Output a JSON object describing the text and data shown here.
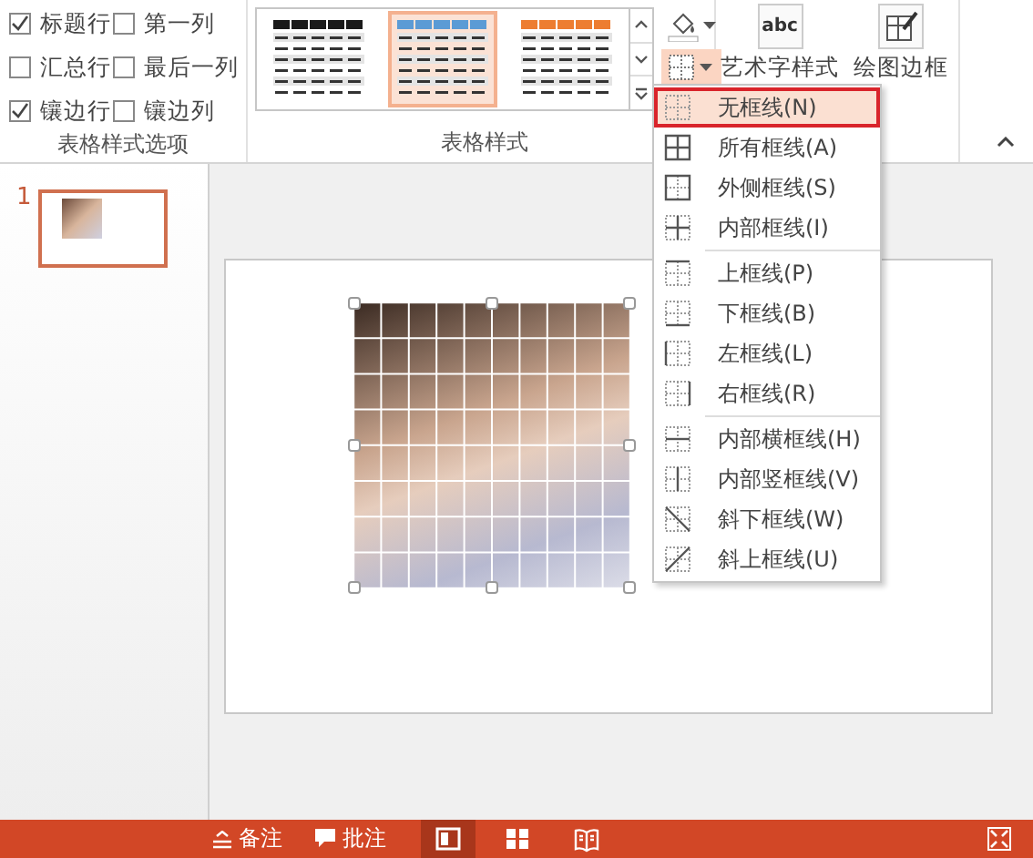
{
  "ribbon": {
    "table_style_options": {
      "label": "表格样式选项",
      "checkboxes": [
        {
          "label": "标题行",
          "checked": true
        },
        {
          "label": "第一列",
          "checked": false
        },
        {
          "label": "汇总行",
          "checked": false
        },
        {
          "label": "最后一列",
          "checked": false
        },
        {
          "label": "镶边行",
          "checked": true
        },
        {
          "label": "镶边列",
          "checked": false
        }
      ]
    },
    "table_styles": {
      "label": "表格样式",
      "styles": [
        {
          "color": "#1a1a1a",
          "selected": false
        },
        {
          "color": "#5b9bd5",
          "selected": true
        },
        {
          "color": "#ed7d31",
          "selected": false
        }
      ],
      "borders_button": {
        "pressed": true
      }
    },
    "wordart": {
      "label": "艺术字样式",
      "icon_text": "abc"
    },
    "draw_borders": {
      "label": "绘图边框"
    }
  },
  "borders_menu": {
    "groups": [
      [
        {
          "label": "无框线(N)",
          "kind": "none",
          "selected": true
        },
        {
          "label": "所有框线(A)",
          "kind": "all",
          "selected": false
        },
        {
          "label": "外侧框线(S)",
          "kind": "outside",
          "selected": false
        },
        {
          "label": "内部框线(I)",
          "kind": "inside",
          "selected": false
        }
      ],
      [
        {
          "label": "上框线(P)",
          "kind": "top",
          "selected": false
        },
        {
          "label": "下框线(B)",
          "kind": "bottom",
          "selected": false
        },
        {
          "label": "左框线(L)",
          "kind": "left",
          "selected": false
        },
        {
          "label": "右框线(R)",
          "kind": "right",
          "selected": false
        }
      ],
      [
        {
          "label": "内部横框线(H)",
          "kind": "inside_h",
          "selected": false
        },
        {
          "label": "内部竖框线(V)",
          "kind": "inside_v",
          "selected": false
        },
        {
          "label": "斜下框线(W)",
          "kind": "diag_down",
          "selected": false
        },
        {
          "label": "斜上框线(U)",
          "kind": "diag_up",
          "selected": false
        }
      ]
    ]
  },
  "slides_panel": {
    "slides": [
      {
        "number": "1",
        "selected": true
      }
    ]
  },
  "status_bar": {
    "notes": "备注",
    "comments": "批注",
    "views": [
      {
        "kind": "normal",
        "selected": true
      },
      {
        "kind": "sorter",
        "selected": false
      },
      {
        "kind": "reading",
        "selected": false
      }
    ]
  }
}
